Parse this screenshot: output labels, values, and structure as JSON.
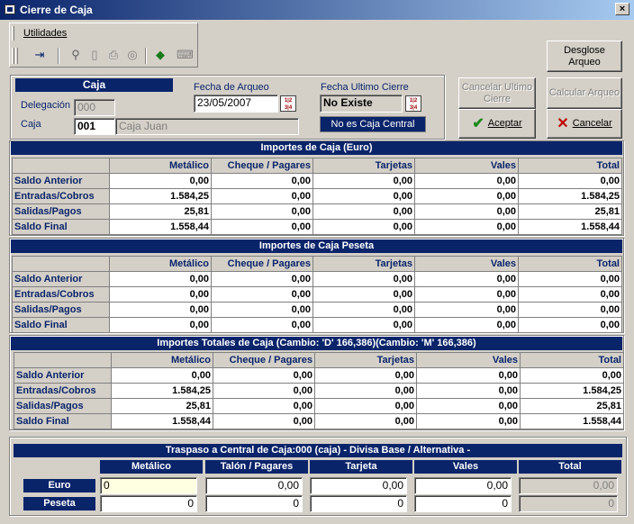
{
  "window": {
    "title": "Cierre de Caja",
    "close_label": "×"
  },
  "toolbar": {
    "menu_label": "Utilidades"
  },
  "caja": {
    "header": "Caja",
    "delegacion_label": "Delegación",
    "delegacion_value": "000",
    "caja_label": "Caja",
    "caja_value": "001",
    "caja_name": "Caja Juan"
  },
  "arqueo": {
    "label": "Fecha de Arqueo",
    "value": "23/05/2007"
  },
  "ultimo_cierre": {
    "label": "Fecha Ultimo Cierre",
    "value": "No Existe",
    "central_status": "No es Caja Central"
  },
  "buttons": {
    "desglose": "Desglose Arqueo",
    "cancelar_ultimo": "Cancelar Ultimo Cierre",
    "calcular": "Calcular Arqueo",
    "aceptar": "Aceptar",
    "cancelar": "Cancelar"
  },
  "columns": [
    "Metálico",
    "Cheque / Pagares",
    "Tarjetas",
    "Vales",
    "Total"
  ],
  "row_labels": [
    "Saldo Anterior",
    "Entradas/Cobros",
    "Salidas/Pagos",
    "Saldo Final"
  ],
  "sections": [
    {
      "title": "Importes de Caja (Euro)",
      "rows": [
        [
          "0,00",
          "0,00",
          "0,00",
          "0,00",
          "0,00"
        ],
        [
          "1.584,25",
          "0,00",
          "0,00",
          "0,00",
          "1.584,25"
        ],
        [
          "25,81",
          "0,00",
          "0,00",
          "0,00",
          "25,81"
        ],
        [
          "1.558,44",
          "0,00",
          "0,00",
          "0,00",
          "1.558,44"
        ]
      ]
    },
    {
      "title": "Importes de Caja  Peseta",
      "rows": [
        [
          "0,00",
          "0,00",
          "0,00",
          "0,00",
          "0,00"
        ],
        [
          "0,00",
          "0,00",
          "0,00",
          "0,00",
          "0,00"
        ],
        [
          "0,00",
          "0,00",
          "0,00",
          "0,00",
          "0,00"
        ],
        [
          "0,00",
          "0,00",
          "0,00",
          "0,00",
          "0,00"
        ]
      ]
    },
    {
      "title": "Importes Totales de Caja (Cambio: 'D' 166,386)(Cambio: 'M' 166,386)",
      "rows": [
        [
          "0,00",
          "0,00",
          "0,00",
          "0,00",
          "0,00"
        ],
        [
          "1.584,25",
          "0,00",
          "0,00",
          "0,00",
          "1.584,25"
        ],
        [
          "25,81",
          "0,00",
          "0,00",
          "0,00",
          "25,81"
        ],
        [
          "1.558,44",
          "0,00",
          "0,00",
          "0,00",
          "1.558,44"
        ]
      ]
    }
  ],
  "traspaso": {
    "title": "Traspaso a Central de Caja:000 (caja) - Divisa Base / Alternativa -",
    "columns": [
      "Metálico",
      "Talón / Pagares",
      "Tarjeta",
      "Vales",
      "Total"
    ],
    "rows": [
      {
        "label": "Euro",
        "values": [
          "0",
          "0,00",
          "0,00",
          "0,00",
          "0,00"
        ]
      },
      {
        "label": "Peseta",
        "values": [
          "0",
          "0",
          "0",
          "0",
          "0"
        ]
      }
    ]
  },
  "colors": {
    "navy": "#0a246a",
    "face": "#d4d0c8",
    "highlight_input": "#ffffe1"
  }
}
